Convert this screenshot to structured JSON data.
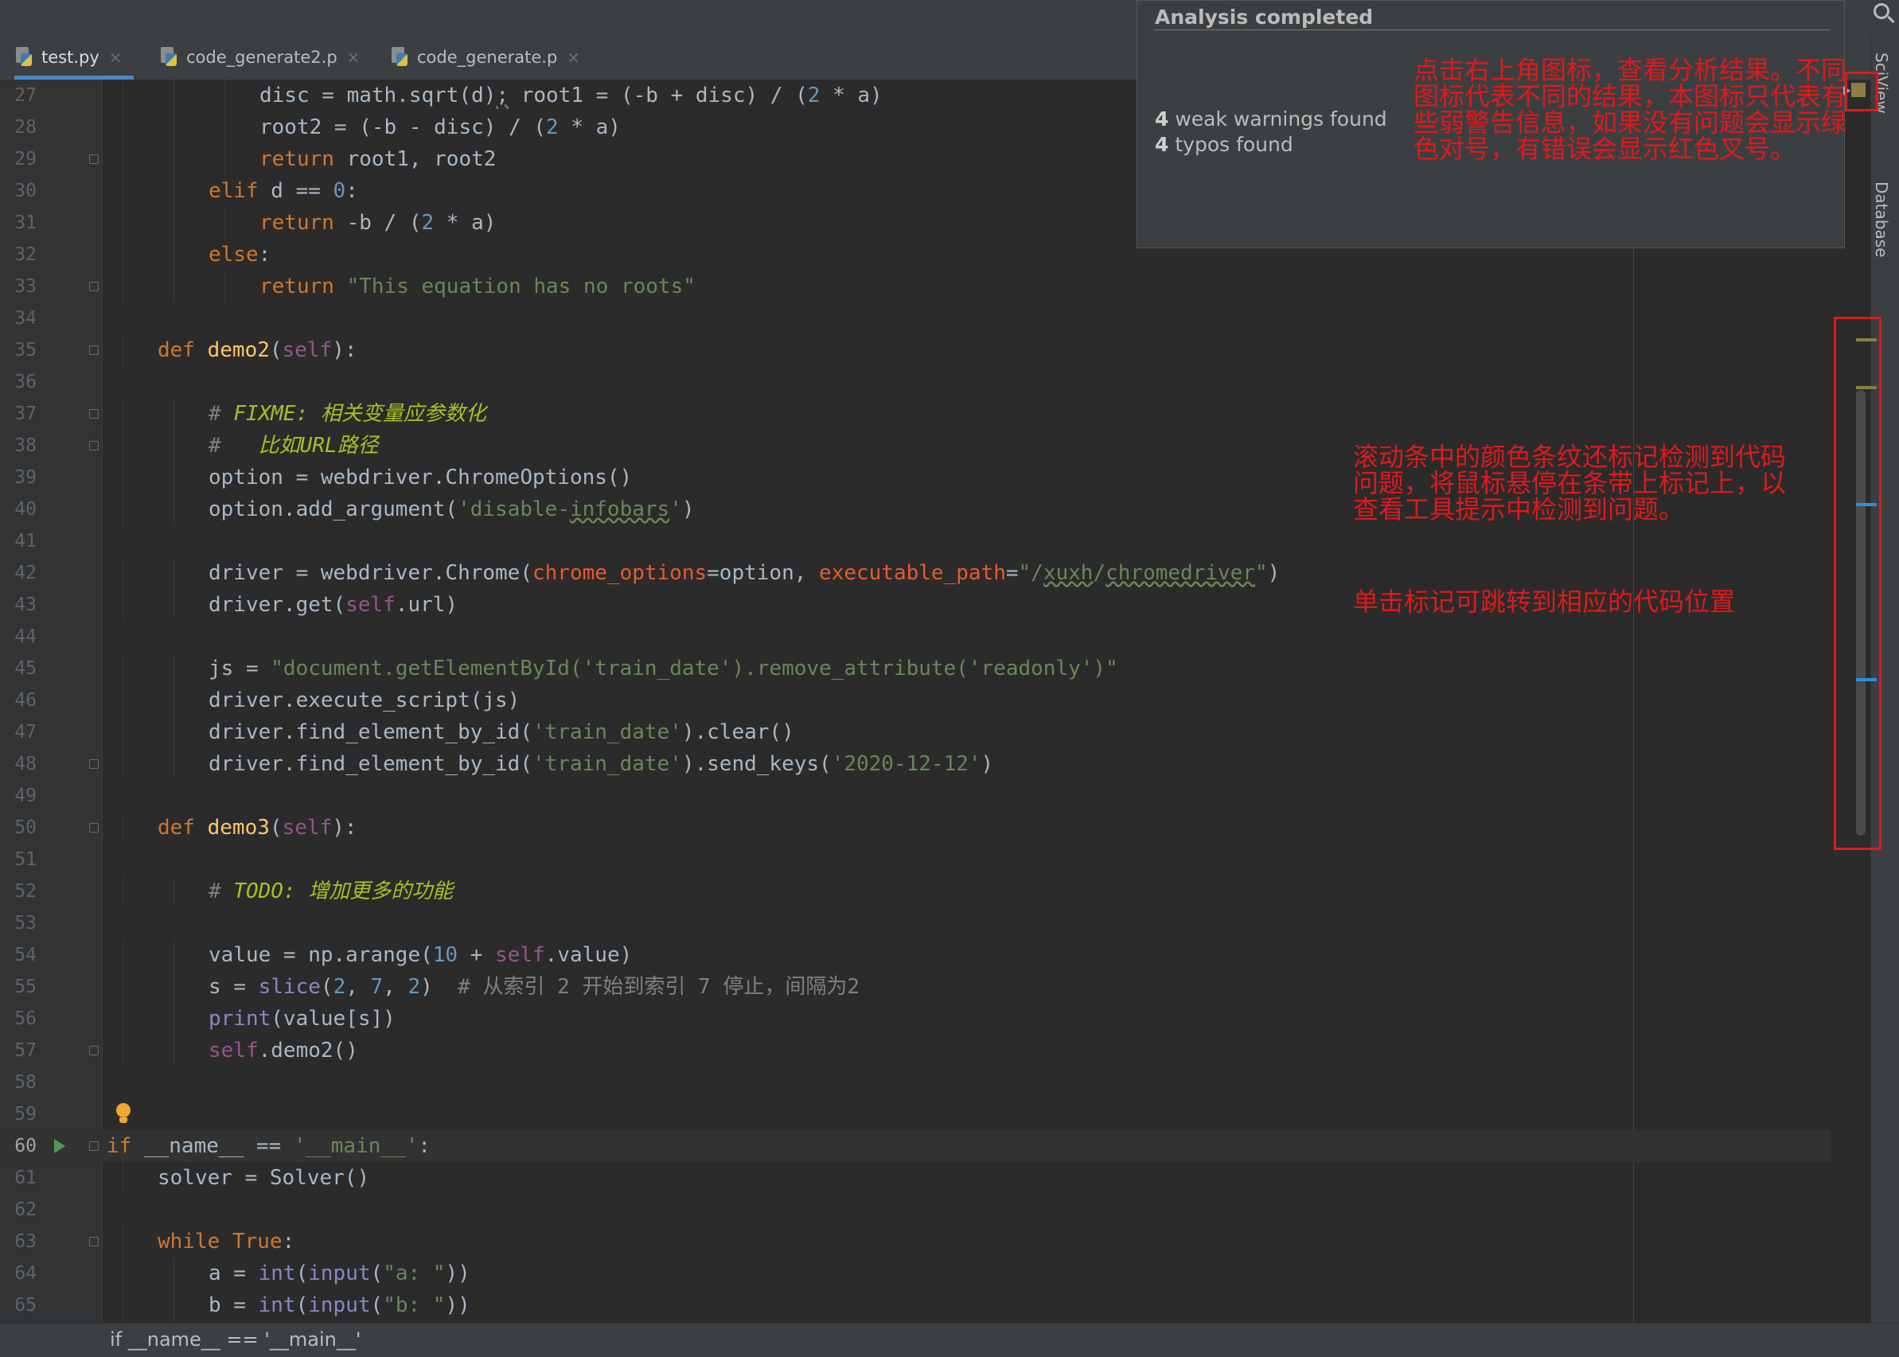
{
  "tabs": [
    {
      "label": "test.py",
      "active": true
    },
    {
      "label": "code_generate2.p",
      "active": false
    },
    {
      "label": "code_generate.p",
      "active": false
    }
  ],
  "popup": {
    "title": "Analysis completed",
    "weak_count": "4",
    "weak_text": " weak warnings found",
    "typo_count": "4",
    "typo_text": " typos found"
  },
  "annotations": {
    "top_right": "点击右上角图标，查看分析结果。不同图标代表不同的结果，本图标只代表有些弱警告信息，如果没有问题会显示绿色对号，有错误会显示红色叉号。",
    "scrollbar": "滚动条中的颜色条纹还标记检测到代码问题，将鼠标悬停在条带上标记上，以查看工具提示中检测到问题。",
    "click_mark": "单击标记可跳转到相应的代码位置"
  },
  "right_panel": {
    "sciview": "SciView",
    "database": "Database"
  },
  "status": {
    "breadcrumb": "if __name__ == '__main__'"
  },
  "colors": {
    "annotation": "#e0191b",
    "warning_marker": "#8e7d47",
    "info_marker": "#2d8fd6",
    "run_icon": "#499c54"
  },
  "code_lines": [
    {
      "n": "27",
      "indent": 3,
      "tokens": [
        [
          "disc = math.sqrt(d)",
          ""
        ],
        [
          ";",
          "typo"
        ],
        [
          " root1 = (-b + disc) / (",
          ""
        ],
        [
          "2",
          "num"
        ],
        [
          " * a)",
          ""
        ]
      ]
    },
    {
      "n": "28",
      "indent": 3,
      "tokens": [
        [
          "root2 = (-b - disc) / (",
          ""
        ],
        [
          "2",
          "num"
        ],
        [
          " * a)",
          ""
        ]
      ]
    },
    {
      "n": "29",
      "indent": 3,
      "fold": true,
      "tokens": [
        [
          "return",
          "kw"
        ],
        [
          " root1, root2",
          ""
        ]
      ]
    },
    {
      "n": "30",
      "indent": 2,
      "tokens": [
        [
          "elif",
          "kw"
        ],
        [
          " d == ",
          ""
        ],
        [
          "0",
          "num"
        ],
        [
          ":",
          ""
        ]
      ]
    },
    {
      "n": "31",
      "indent": 3,
      "tokens": [
        [
          "return",
          "kw"
        ],
        [
          " -b / (",
          ""
        ],
        [
          "2",
          "num"
        ],
        [
          " * a)",
          ""
        ]
      ]
    },
    {
      "n": "32",
      "indent": 2,
      "tokens": [
        [
          "else",
          "kw"
        ],
        [
          ":",
          ""
        ]
      ]
    },
    {
      "n": "33",
      "indent": 3,
      "fold": true,
      "tokens": [
        [
          "return",
          "kw"
        ],
        [
          " ",
          ""
        ],
        [
          "\"This equation has no roots\"",
          "str"
        ]
      ]
    },
    {
      "n": "34",
      "indent": 0,
      "tokens": []
    },
    {
      "n": "35",
      "indent": 1,
      "fold": true,
      "tokens": [
        [
          "def",
          "kw"
        ],
        [
          " ",
          ""
        ],
        [
          "demo2",
          "fn"
        ],
        [
          "(",
          ""
        ],
        [
          "self",
          "self"
        ],
        [
          "):",
          ""
        ]
      ]
    },
    {
      "n": "36",
      "indent": 0,
      "tokens": []
    },
    {
      "n": "37",
      "indent": 2,
      "fold": true,
      "tokens": [
        [
          "# ",
          "cmt"
        ],
        [
          "FIXME: 相关变量应参数化",
          "todo"
        ]
      ]
    },
    {
      "n": "38",
      "indent": 2,
      "fold": true,
      "tokens": [
        [
          "#   ",
          "cmt"
        ],
        [
          "比如URL路径",
          "todo"
        ]
      ]
    },
    {
      "n": "39",
      "indent": 2,
      "tokens": [
        [
          "option = webdriver.ChromeOptions()",
          ""
        ]
      ]
    },
    {
      "n": "40",
      "indent": 2,
      "tokens": [
        [
          "option.add_argument(",
          ""
        ],
        [
          "'disable-",
          "str"
        ],
        [
          "infobars",
          "str typo"
        ],
        [
          "'",
          "str"
        ],
        [
          ")",
          ""
        ]
      ]
    },
    {
      "n": "41",
      "indent": 0,
      "tokens": []
    },
    {
      "n": "42",
      "indent": 2,
      "tokens": [
        [
          "driver = webdriver.Chrome(",
          ""
        ],
        [
          "chrome_options",
          "param"
        ],
        [
          "=option, ",
          ""
        ],
        [
          "executable_path",
          "param"
        ],
        [
          "=",
          ""
        ],
        [
          "\"/",
          "str"
        ],
        [
          "xuxh",
          "str typo"
        ],
        [
          "/",
          "str"
        ],
        [
          "chromedriver",
          "str typo"
        ],
        [
          "\"",
          "str"
        ],
        [
          ")",
          ""
        ]
      ]
    },
    {
      "n": "43",
      "indent": 2,
      "tokens": [
        [
          "driver.get(",
          ""
        ],
        [
          "self",
          "self"
        ],
        [
          ".url)",
          ""
        ]
      ]
    },
    {
      "n": "44",
      "indent": 0,
      "tokens": []
    },
    {
      "n": "45",
      "indent": 2,
      "tokens": [
        [
          "js = ",
          ""
        ],
        [
          "\"document.getElementById('train_date').remove_attribute('readonly')\"",
          "str"
        ]
      ]
    },
    {
      "n": "46",
      "indent": 2,
      "tokens": [
        [
          "driver.execute_script(js)",
          ""
        ]
      ]
    },
    {
      "n": "47",
      "indent": 2,
      "tokens": [
        [
          "driver.find_element_by_id(",
          ""
        ],
        [
          "'train_date'",
          "str"
        ],
        [
          ").clear()",
          ""
        ]
      ]
    },
    {
      "n": "48",
      "indent": 2,
      "fold": true,
      "tokens": [
        [
          "driver.find_element_by_id(",
          ""
        ],
        [
          "'train_date'",
          "str"
        ],
        [
          ").send_keys(",
          ""
        ],
        [
          "'2020-12-12'",
          "str"
        ],
        [
          ")",
          ""
        ]
      ]
    },
    {
      "n": "49",
      "indent": 0,
      "tokens": []
    },
    {
      "n": "50",
      "indent": 1,
      "fold": true,
      "tokens": [
        [
          "def",
          "kw"
        ],
        [
          " ",
          ""
        ],
        [
          "demo3",
          "fn"
        ],
        [
          "(",
          ""
        ],
        [
          "self",
          "self"
        ],
        [
          "):",
          ""
        ]
      ]
    },
    {
      "n": "51",
      "indent": 0,
      "tokens": []
    },
    {
      "n": "52",
      "indent": 2,
      "tokens": [
        [
          "# ",
          "cmt"
        ],
        [
          "TODO: 增加更多的功能",
          "todo"
        ]
      ]
    },
    {
      "n": "53",
      "indent": 0,
      "tokens": []
    },
    {
      "n": "54",
      "indent": 2,
      "tokens": [
        [
          "value = np.arange(",
          ""
        ],
        [
          "10",
          "num"
        ],
        [
          " + ",
          ""
        ],
        [
          "self",
          "self"
        ],
        [
          ".value)",
          ""
        ]
      ]
    },
    {
      "n": "55",
      "indent": 2,
      "tokens": [
        [
          "s = ",
          ""
        ],
        [
          "slice",
          "bi"
        ],
        [
          "(",
          ""
        ],
        [
          "2",
          "num"
        ],
        [
          ", ",
          ""
        ],
        [
          "7",
          "num"
        ],
        [
          ", ",
          ""
        ],
        [
          "2",
          "num"
        ],
        [
          ")  ",
          ""
        ],
        [
          "# 从索引 2 开始到索引 7 停止，间隔为2",
          "cmt"
        ]
      ]
    },
    {
      "n": "56",
      "indent": 2,
      "tokens": [
        [
          "print",
          "bi"
        ],
        [
          "(value[s])",
          ""
        ]
      ]
    },
    {
      "n": "57",
      "indent": 2,
      "fold": true,
      "tokens": [
        [
          "self",
          "self"
        ],
        [
          ".demo2()",
          ""
        ]
      ]
    },
    {
      "n": "58",
      "indent": 0,
      "tokens": []
    },
    {
      "n": "59",
      "indent": 0,
      "bulb": true,
      "tokens": []
    },
    {
      "n": "60",
      "indent": 0,
      "current": true,
      "run": true,
      "fold": true,
      "tokens": [
        [
          "if",
          "kw"
        ],
        [
          " __name__ == ",
          ""
        ],
        [
          "'__main__'",
          "str"
        ],
        [
          ":",
          ""
        ]
      ]
    },
    {
      "n": "61",
      "indent": 1,
      "tokens": [
        [
          "solver = Solver()",
          ""
        ]
      ]
    },
    {
      "n": "62",
      "indent": 0,
      "tokens": []
    },
    {
      "n": "63",
      "indent": 1,
      "fold": true,
      "tokens": [
        [
          "while",
          "kw"
        ],
        [
          " ",
          ""
        ],
        [
          "True",
          "kw"
        ],
        [
          ":",
          ""
        ]
      ]
    },
    {
      "n": "64",
      "indent": 2,
      "tokens": [
        [
          "a = ",
          ""
        ],
        [
          "int",
          "bi"
        ],
        [
          "(",
          ""
        ],
        [
          "input",
          "bi"
        ],
        [
          "(",
          ""
        ],
        [
          "\"a: \"",
          "str"
        ],
        [
          "))",
          ""
        ]
      ]
    },
    {
      "n": "65",
      "indent": 2,
      "tokens": [
        [
          "b = ",
          ""
        ],
        [
          "int",
          "bi"
        ],
        [
          "(",
          ""
        ],
        [
          "input",
          "bi"
        ],
        [
          "(",
          ""
        ],
        [
          "\"b: \"",
          "str"
        ],
        [
          "))",
          ""
        ]
      ]
    }
  ]
}
